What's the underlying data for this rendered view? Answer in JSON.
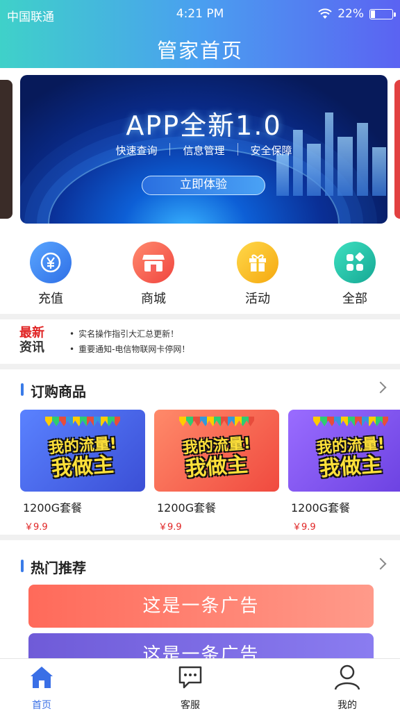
{
  "status_bar": {
    "carrier": "中国联通",
    "time": "4:21 PM",
    "battery": "22%",
    "battery_level": 0.22
  },
  "header": {
    "title": "管家首页"
  },
  "banner": {
    "headline": "APP全新1.0",
    "features": [
      "快速查询",
      "信息管理",
      "安全保障"
    ],
    "cta": "立即体验"
  },
  "quick_nav": [
    {
      "label": "充值",
      "icon": "yen-icon",
      "color": "#3f8af0"
    },
    {
      "label": "商城",
      "icon": "store-icon",
      "color": "#f5615a"
    },
    {
      "label": "活动",
      "icon": "gift-icon",
      "color": "#f7c21a"
    },
    {
      "label": "全部",
      "icon": "apps-icon",
      "color": "#22c2a8"
    }
  ],
  "news": {
    "badge_line1": "最新",
    "badge_line2": "资讯",
    "items": [
      "实名操作指引大汇总更新！",
      "重要通知-电信物联网卡停网！"
    ]
  },
  "products_section": {
    "title": "订购商品",
    "items": [
      {
        "name": "1200G套餐",
        "price": "￥9.9",
        "art_line1": "我的流量!",
        "art_line2": "我做主",
        "color": "#4f6ef0"
      },
      {
        "name": "1200G套餐",
        "price": "￥9.9",
        "art_line1": "我的流量!",
        "art_line2": "我做主",
        "color": "#f55d4f"
      },
      {
        "name": "1200G套餐",
        "price": "￥9.9",
        "art_line1": "我的流量!",
        "art_line2": "我做主",
        "color": "#7a50e8"
      }
    ]
  },
  "hot_section": {
    "title": "热门推荐",
    "ads": [
      "这是一条广告",
      "这是一条广告"
    ]
  },
  "tabbar": {
    "items": [
      {
        "label": "首页",
        "icon": "home-icon",
        "active": true
      },
      {
        "label": "客服",
        "icon": "chat-icon",
        "active": false
      },
      {
        "label": "我的",
        "icon": "user-icon",
        "active": false
      }
    ]
  }
}
